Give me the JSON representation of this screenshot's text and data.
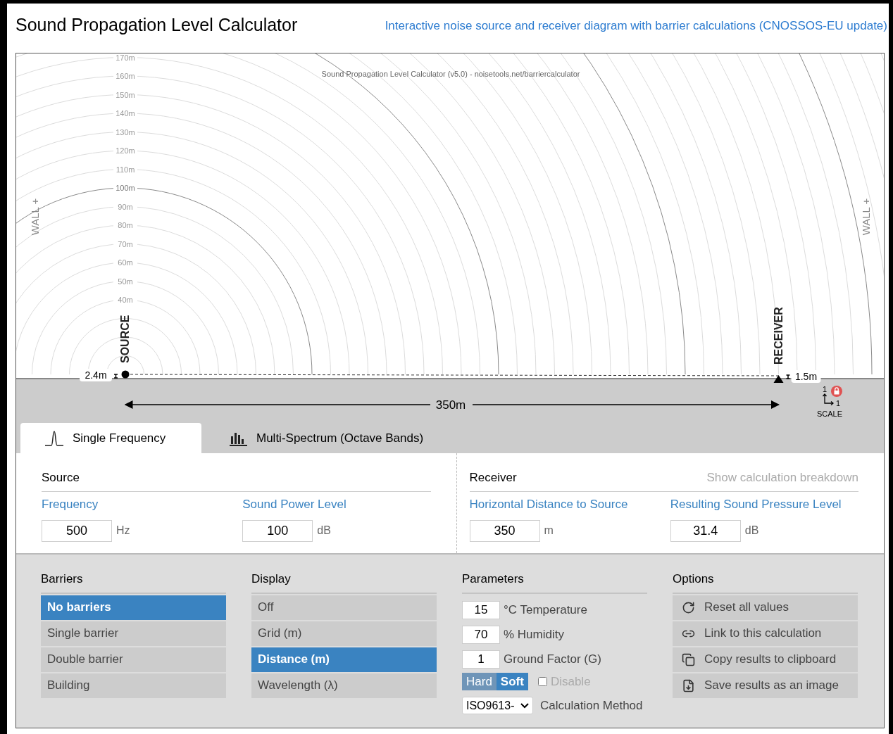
{
  "header": {
    "title": "Sound Propagation Level Calculator",
    "subtitle": "Interactive noise source and receiver diagram with barrier calculations (CNOSSOS-EU update)"
  },
  "diagram": {
    "caption": "Sound Propagation Level Calculator (v5.0) - noisetools.net/barriercalculator",
    "ring_labels": [
      "170m",
      "160m",
      "150m",
      "140m",
      "130m",
      "120m",
      "110m",
      "100m",
      "90m",
      "80m",
      "70m",
      "60m",
      "50m",
      "40m"
    ],
    "wall_labels": [
      "WALL +",
      "WALL +"
    ],
    "source_label": "SOURCE",
    "source_height": "2.4m",
    "receiver_label": "RECEIVER",
    "receiver_height": "1.5m",
    "distance": "350m",
    "scale": {
      "label": "SCALE",
      "y_ratio": "1",
      "x_ratio": "1"
    }
  },
  "tabs": [
    {
      "label": "Single Frequency",
      "selected": true,
      "kind": "single"
    },
    {
      "label": "Multi-Spectrum (Octave Bands)",
      "selected": false,
      "kind": "spectrum"
    }
  ],
  "source": {
    "heading": "Source",
    "fields": [
      {
        "label": "Frequency",
        "value": "500",
        "unit": "Hz"
      },
      {
        "label": "Sound Power Level",
        "value": "100",
        "unit": "dB"
      }
    ]
  },
  "receiver": {
    "heading": "Receiver",
    "link": "Show calculation breakdown",
    "fields": [
      {
        "label": "Horizontal Distance to Source",
        "value": "350",
        "unit": "m"
      },
      {
        "label": "Resulting Sound Pressure Level",
        "value": "31.4",
        "unit": "dB"
      }
    ]
  },
  "barriers": {
    "heading": "Barriers",
    "items": [
      {
        "label": "No barriers",
        "selected": true
      },
      {
        "label": "Single barrier",
        "selected": false
      },
      {
        "label": "Double barrier",
        "selected": false
      },
      {
        "label": "Building",
        "selected": false
      }
    ]
  },
  "display": {
    "heading": "Display",
    "items": [
      {
        "label": "Off",
        "selected": false
      },
      {
        "label": "Grid (m)",
        "selected": false
      },
      {
        "label": "Distance (m)",
        "selected": true
      },
      {
        "label": "Wavelength (λ)",
        "selected": false
      }
    ]
  },
  "parameters": {
    "heading": "Parameters",
    "inputs": [
      {
        "value": "15",
        "label": "°C Temperature"
      },
      {
        "value": "70",
        "label": "% Humidity"
      },
      {
        "value": "1",
        "label": "Ground Factor (G)"
      }
    ],
    "ground_type": [
      {
        "label": "Hard",
        "selected": false
      },
      {
        "label": "Soft",
        "selected": true
      }
    ],
    "disable": {
      "label": "Disable",
      "checked": false
    },
    "method": {
      "value": "ISO9613-",
      "label": "Calculation Method"
    }
  },
  "options": {
    "heading": "Options",
    "items": [
      {
        "label": "Reset all values",
        "kind": "reset"
      },
      {
        "label": "Link to this calculation",
        "kind": "link"
      },
      {
        "label": "Copy results to clipboard",
        "kind": "copy"
      },
      {
        "label": "Save results as an image",
        "kind": "save"
      }
    ]
  }
}
